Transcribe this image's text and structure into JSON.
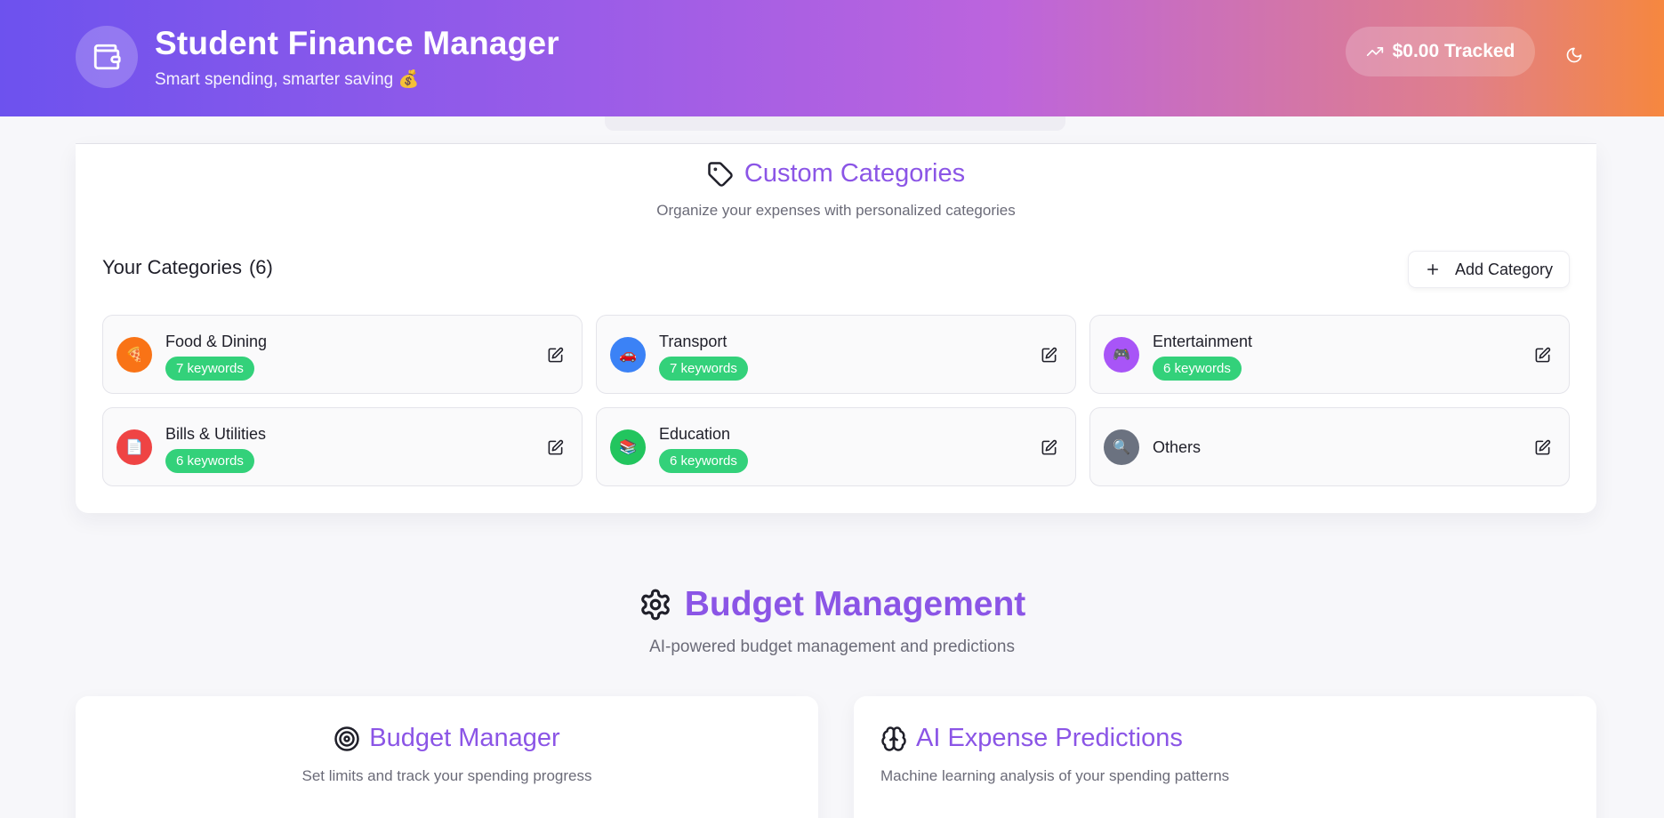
{
  "header": {
    "title": "Student Finance Manager",
    "subtitle": "Smart spending, smarter saving 💰",
    "tracked_label": "$0.00 Tracked",
    "icons": {
      "logo": "wallet-icon",
      "tracked": "trending-up-icon",
      "theme": "moon-icon"
    }
  },
  "categories": {
    "heading": "Custom Categories",
    "heading_icon": "tag-icon",
    "subtitle": "Organize your expenses with personalized categories",
    "list_label": "Your Categories",
    "count_label": "(6)",
    "add_button": "Add Category",
    "items": [
      {
        "name": "Food & Dining",
        "keywords": "7 keywords",
        "color": "#f97316",
        "emoji": "🍕"
      },
      {
        "name": "Transport",
        "keywords": "7 keywords",
        "color": "#3b82f6",
        "emoji": "🚗"
      },
      {
        "name": "Entertainment",
        "keywords": "6 keywords",
        "color": "#a855f7",
        "emoji": "🎮"
      },
      {
        "name": "Bills & Utilities",
        "keywords": "6 keywords",
        "color": "#ef4444",
        "emoji": "📄"
      },
      {
        "name": "Education",
        "keywords": "6 keywords",
        "color": "#22c55e",
        "emoji": "📚"
      },
      {
        "name": "Others",
        "keywords": "",
        "color": "#6b7280",
        "emoji": "🔍"
      }
    ]
  },
  "budget": {
    "heading": "Budget Management",
    "heading_icon": "gear-icon",
    "subtitle": "AI-powered budget management and predictions",
    "manager": {
      "title": "Budget Manager",
      "icon": "target-icon",
      "subtitle": "Set limits and track your spending progress"
    },
    "predictions": {
      "title": "AI Expense Predictions",
      "icon": "brain-icon",
      "subtitle": "Machine learning analysis of your spending patterns"
    }
  },
  "colors": {
    "accent": "#8b55e6",
    "badge": "#33d17a"
  }
}
